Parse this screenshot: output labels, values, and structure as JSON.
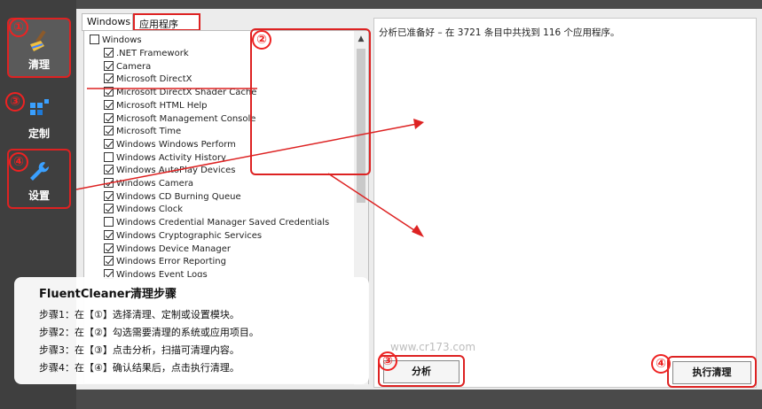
{
  "sidebar": {
    "items": [
      {
        "label": "清理",
        "badge": "①"
      },
      {
        "label": "定制",
        "badge": "③"
      },
      {
        "label": "设置",
        "badge": "④"
      }
    ]
  },
  "tabs": {
    "windows": "Windows",
    "apps": "应用程序"
  },
  "list": {
    "header": {
      "label": "Windows",
      "checked": false
    },
    "items": [
      {
        "label": ".NET Framework",
        "checked": true
      },
      {
        "label": "Camera",
        "checked": true
      },
      {
        "label": "Microsoft DirectX",
        "checked": true
      },
      {
        "label": "Microsoft DirectX Shader Cache",
        "checked": true
      },
      {
        "label": "Microsoft HTML Help",
        "checked": true
      },
      {
        "label": "Microsoft Management Console",
        "checked": true
      },
      {
        "label": "Microsoft Time",
        "checked": true
      },
      {
        "label": "Windows Windows Perform",
        "checked": true
      },
      {
        "label": "Windows Activity History",
        "checked": false
      },
      {
        "label": "Windows AutoPlay Devices",
        "checked": true
      },
      {
        "label": "Windows Camera",
        "checked": true
      },
      {
        "label": "Windows CD Burning Queue",
        "checked": true
      },
      {
        "label": "Windows Clock",
        "checked": true
      },
      {
        "label": "Windows Credential Manager Saved Credentials",
        "checked": false
      },
      {
        "label": "Windows Cryptographic Services",
        "checked": true
      },
      {
        "label": "Windows Device Manager",
        "checked": true
      },
      {
        "label": "Windows Error Reporting",
        "checked": true
      },
      {
        "label": "Windows Event Logs",
        "checked": true
      }
    ],
    "badge": "②"
  },
  "status": "分析已准备好 – 在 3721 条目中共找到 116 个应用程序。",
  "buttons": {
    "analyze": "分析",
    "execute": "执行清理",
    "analyze_badge": "③",
    "execute_badge": "④"
  },
  "watermark": "www.cr173.com",
  "overlay": {
    "title": "FluentCleaner清理步骤",
    "steps": [
      "步骤1：在【①】选择清理、定制或设置模块。",
      "步骤2：在【②】勾选需要清理的系统或应用项目。",
      "步骤3：在【③】点击分析，扫描可清理内容。",
      "步骤4：在【④】确认结果后，点击执行清理。"
    ]
  },
  "colors": {
    "accent": "#dd2222",
    "sidebar": "#3f3f3f"
  }
}
